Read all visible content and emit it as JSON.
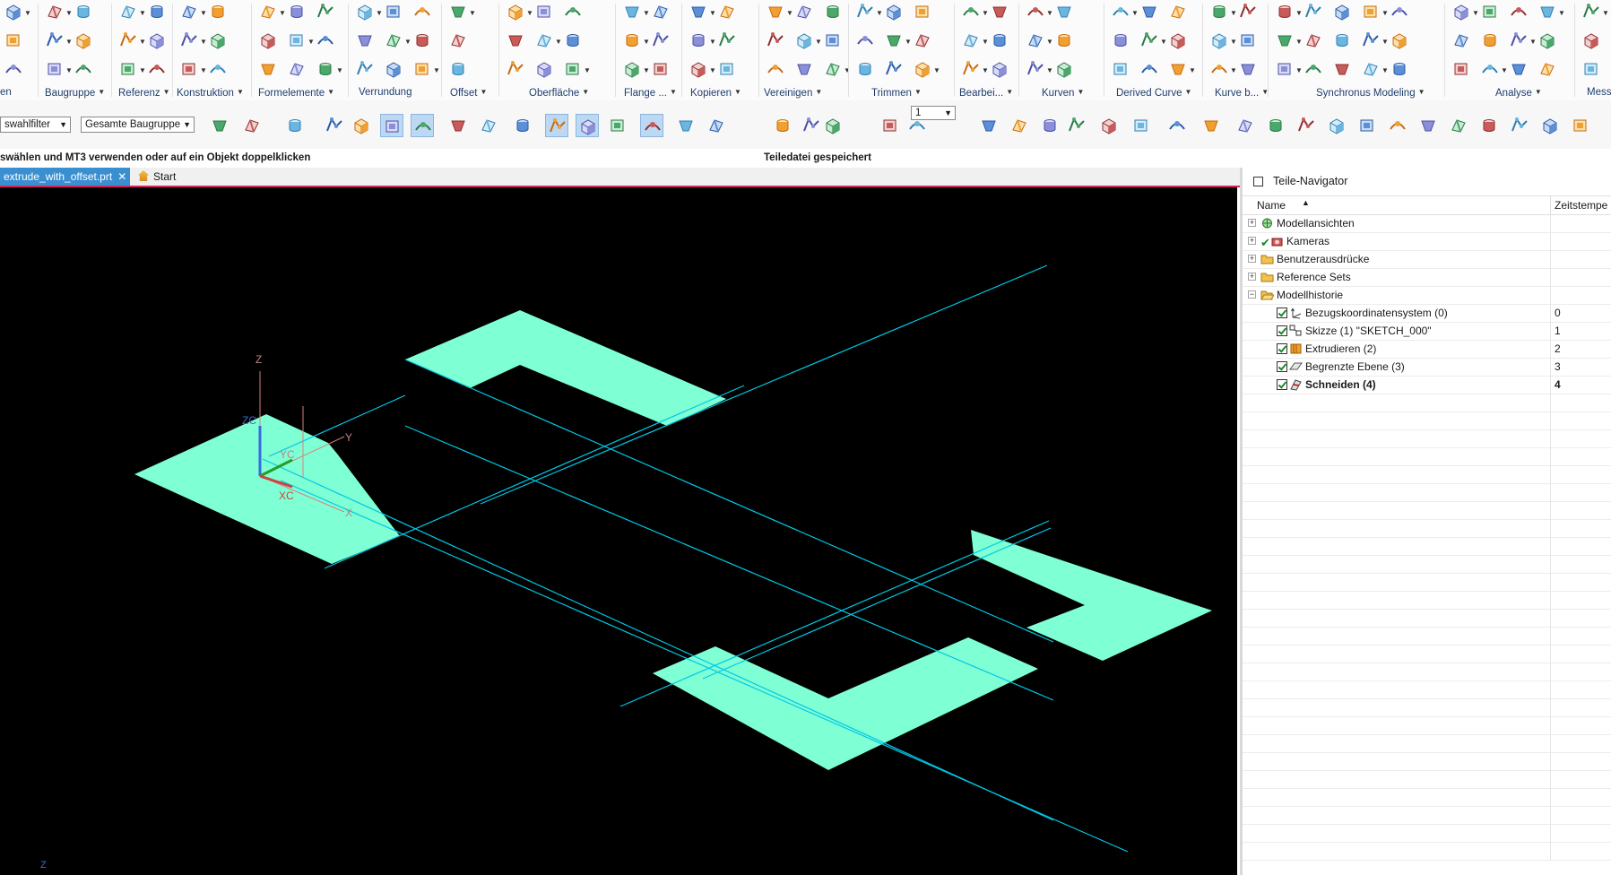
{
  "ribbon": {
    "groups": [
      {
        "label": "en",
        "caret": false
      },
      {
        "label": "Baugruppe",
        "caret": true
      },
      {
        "label": "Referenz",
        "caret": true
      },
      {
        "label": "Konstruktion",
        "caret": true
      },
      {
        "label": "Formelemente",
        "caret": true
      },
      {
        "label": "Verrundung",
        "caret": false
      },
      {
        "label": "Offset",
        "caret": true
      },
      {
        "label": "Oberfläche",
        "caret": true
      },
      {
        "label": "Flange ...",
        "caret": true
      },
      {
        "label": "Kopieren",
        "caret": true
      },
      {
        "label": "Vereinigen",
        "caret": true
      },
      {
        "label": "Trimmen",
        "caret": true
      },
      {
        "label": "Bearbei...",
        "caret": true
      },
      {
        "label": "Kurven",
        "caret": true
      },
      {
        "label": "Derived Curve",
        "caret": true
      },
      {
        "label": "Kurve b...",
        "caret": true
      },
      {
        "label": "Synchronus Modeling",
        "caret": true
      },
      {
        "label": "Analyse",
        "caret": true
      },
      {
        "label": "Messd...",
        "caret": false
      }
    ]
  },
  "toolbar": {
    "filter_label": "swahlfilter",
    "assembly_label": "Gesamte Baugruppe",
    "layer_value": "1"
  },
  "status": {
    "prompt": "swählen und MT3 verwenden oder auf ein Objekt doppelklicken",
    "message": "Teiledatei gespeichert"
  },
  "tabs": [
    {
      "label": "extrude_with_offset.prt",
      "active": true
    },
    {
      "label": "Start",
      "active": false
    }
  ],
  "viewport": {
    "background": "#000000",
    "face_color": "#7fffd4",
    "edge_color": "#00c8e6",
    "triad": {
      "z": "Z",
      "zc": "ZC",
      "yc": "YC",
      "xc": "XC",
      "y": "Y",
      "x": "X"
    },
    "corner_label": "Z"
  },
  "navigator": {
    "title": "Teile-Navigator",
    "columns": {
      "name": "Name",
      "timestamp": "Zeitstempe"
    },
    "rows": [
      {
        "label": "Modellansichten",
        "level": 0,
        "toggle": "+",
        "icon": "views-icon",
        "check": false,
        "ts": "",
        "bold": false
      },
      {
        "label": "Kameras",
        "level": 0,
        "toggle": "+",
        "icon": "camera-icon",
        "check": false,
        "ts": "",
        "bold": false
      },
      {
        "label": "Benutzerausdrücke",
        "level": 0,
        "toggle": "+",
        "icon": "folder-icon",
        "check": false,
        "ts": "",
        "bold": false
      },
      {
        "label": "Reference Sets",
        "level": 0,
        "toggle": "+",
        "icon": "folder-icon",
        "check": false,
        "ts": "",
        "bold": false
      },
      {
        "label": "Modellhistorie",
        "level": 0,
        "toggle": "−",
        "icon": "folder-open-icon",
        "check": false,
        "ts": "",
        "bold": false
      },
      {
        "label": "Bezugskoordinatensystem (0)",
        "level": 1,
        "toggle": "",
        "icon": "datum-csys-icon",
        "check": true,
        "ts": "0",
        "bold": false
      },
      {
        "label": "Skizze (1) \"SKETCH_000\"",
        "level": 1,
        "toggle": "",
        "icon": "sketch-icon",
        "check": true,
        "ts": "1",
        "bold": false
      },
      {
        "label": "Extrudieren (2)",
        "level": 1,
        "toggle": "",
        "icon": "extrude-icon",
        "check": true,
        "ts": "2",
        "bold": false
      },
      {
        "label": "Begrenzte Ebene (3)",
        "level": 1,
        "toggle": "",
        "icon": "bounded-plane-icon",
        "check": true,
        "ts": "3",
        "bold": false
      },
      {
        "label": "Schneiden (4)",
        "level": 1,
        "toggle": "",
        "icon": "section-icon",
        "check": true,
        "ts": "4",
        "bold": true
      }
    ]
  }
}
